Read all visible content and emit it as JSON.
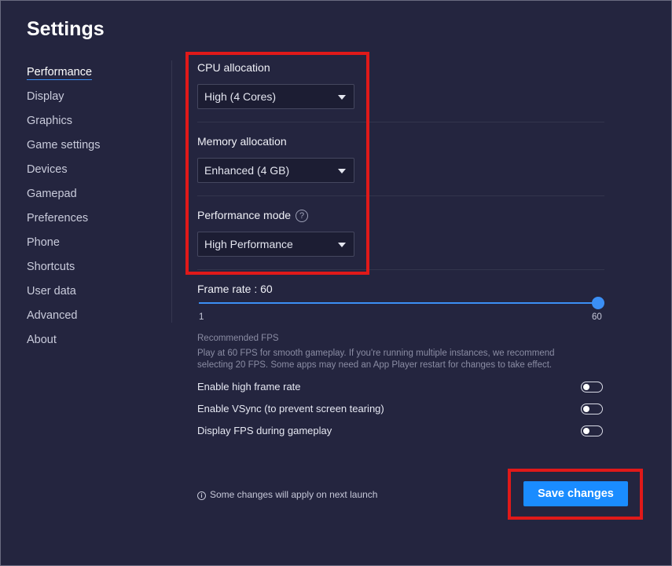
{
  "title": "Settings",
  "sidebar": {
    "items": [
      {
        "label": "Performance",
        "active": true
      },
      {
        "label": "Display"
      },
      {
        "label": "Graphics"
      },
      {
        "label": "Game settings"
      },
      {
        "label": "Devices"
      },
      {
        "label": "Gamepad"
      },
      {
        "label": "Preferences"
      },
      {
        "label": "Phone"
      },
      {
        "label": "Shortcuts"
      },
      {
        "label": "User data"
      },
      {
        "label": "Advanced"
      },
      {
        "label": "About"
      }
    ]
  },
  "cpu": {
    "label": "CPU allocation",
    "value": "High (4 Cores)"
  },
  "memory": {
    "label": "Memory allocation",
    "value": "Enhanced (4 GB)"
  },
  "perf_mode": {
    "label": "Performance mode",
    "help": "?",
    "value": "High Performance"
  },
  "frame_rate": {
    "label": "Frame rate : 60",
    "min": "1",
    "max": "60",
    "value": 60
  },
  "fps_help": {
    "title": "Recommended FPS",
    "line1": "Play at 60 FPS for smooth gameplay. If you're running multiple instances, we recommend",
    "line2": "selecting 20 FPS. Some apps may need an App Player restart for changes to take effect."
  },
  "toggles": [
    {
      "label": "Enable high frame rate",
      "on": false
    },
    {
      "label": "Enable VSync (to prevent screen tearing)",
      "on": false
    },
    {
      "label": "Display FPS during gameplay",
      "on": false
    }
  ],
  "footer": {
    "info_icon": "i",
    "note": "Some changes will apply on next launch",
    "save_label": "Save changes"
  },
  "colors": {
    "accent": "#1a8cff",
    "background": "#24253f",
    "highlight": "#e01919"
  }
}
